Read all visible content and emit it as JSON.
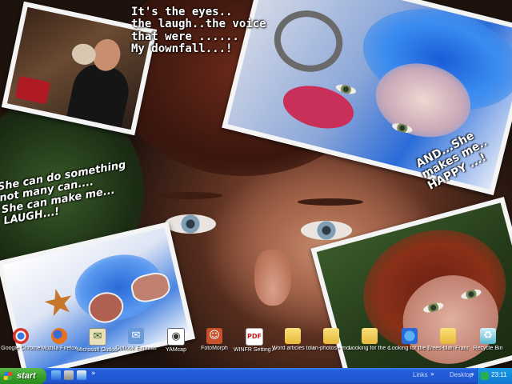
{
  "wallpaper": {
    "caption_top": "It's the eyes..\nthe laugh..the voice\nthat were ......\nMy downfall...!",
    "caption_left": "She can do something\nnot many can....\nShe can make me...\nLAUGH...!",
    "caption_right": "AND...She\nmakes me..\nHAPPY ...!"
  },
  "desktop_icons": [
    {
      "label": "Google Chrome",
      "icon": "chrome-icon"
    },
    {
      "label": "Mozilla Firefox",
      "icon": "firefox-icon"
    },
    {
      "label": "Microsoft Outlook",
      "icon": "outlook-icon"
    },
    {
      "label": "Outlook Express",
      "icon": "outlook-express-icon"
    },
    {
      "label": "YAMcap",
      "icon": "ymcam-icon"
    },
    {
      "label": "FotoMorph",
      "icon": "fotomorph-icon"
    },
    {
      "label": "WINFR Setting Around the...",
      "icon": "pdf-icon"
    },
    {
      "label": "Word articles to edit the...",
      "icon": "folder-icon"
    },
    {
      "label": "Ian-photos+ movies off...",
      "icon": "folder-icon"
    },
    {
      "label": "Looking for the current time ...",
      "icon": "folder-icon"
    },
    {
      "label": "Looking for the current time ...",
      "icon": "globe-icon"
    },
    {
      "label": "Trees-blah France... pub",
      "icon": "folder-icon"
    },
    {
      "label": "Recycle Bin",
      "icon": "recycle-bin-icon"
    }
  ],
  "taskbar": {
    "start_label": "start",
    "links_label": "Links",
    "desktop_label": "Desktop",
    "clock": "23:11"
  }
}
